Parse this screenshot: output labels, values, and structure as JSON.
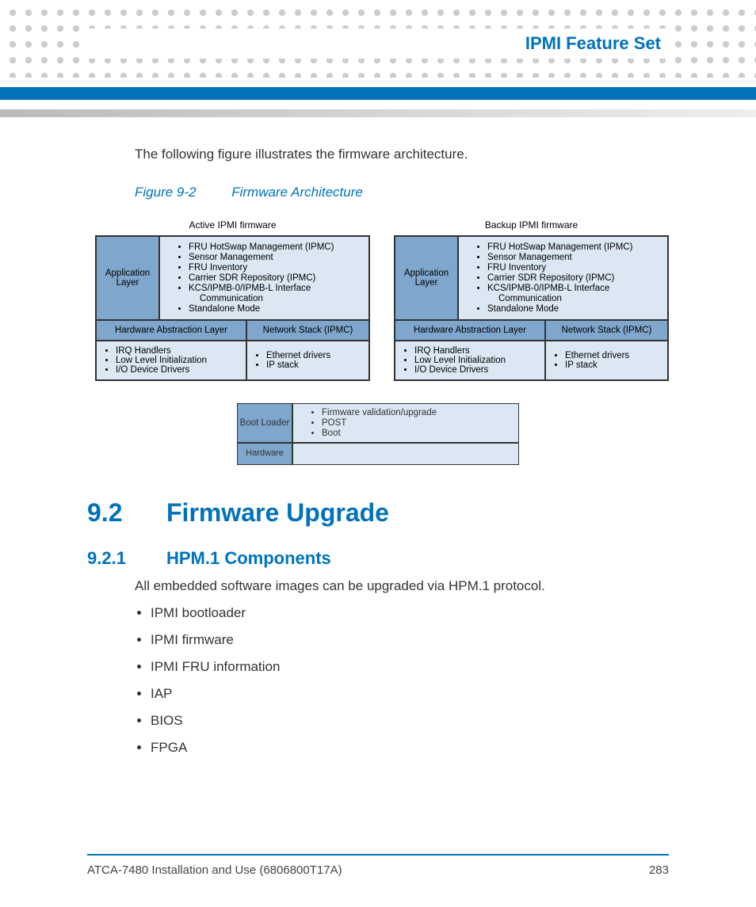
{
  "header": {
    "title": "IPMI Feature Set"
  },
  "intro": "The following figure illustrates the firmware architecture.",
  "figure": {
    "number": "Figure 9-2",
    "title": "Firmware Architecture",
    "active": {
      "title": "Active IPMI firmware",
      "app_label": "Application Layer",
      "app_items": [
        "FRU HotSwap Management (IPMC)",
        "Sensor Management",
        "FRU Inventory",
        "Carrier SDR Repository (IPMC)",
        "KCS/IPMB-0/IPMB-L Interface",
        "Communication",
        "Standalone Mode"
      ],
      "hal_left": "Hardware Abstraction Layer",
      "hal_right": "Network Stack (IPMC)",
      "low_left": [
        "IRQ Handlers",
        "Low Level Initialization",
        "I/O Device Drivers"
      ],
      "low_right": [
        "Ethernet drivers",
        "IP stack"
      ]
    },
    "backup": {
      "title": "Backup IPMI firmware",
      "app_label": "Application Layer",
      "app_items": [
        "FRU HotSwap Management (IPMC)",
        "Sensor Management",
        "FRU Inventory",
        "Carrier SDR Repository (IPMC)",
        "KCS/IPMB-0/IPMB-L Interface",
        "Communication",
        "Standalone Mode"
      ],
      "hal_left": "Hardware Abstraction Layer",
      "hal_right": "Network Stack (IPMC)",
      "low_left": [
        "IRQ Handlers",
        "Low Level Initialization",
        "I/O Device Drivers"
      ],
      "low_right": [
        "Ethernet drivers",
        "IP stack"
      ]
    },
    "boot": {
      "label": "Boot Loader",
      "items": [
        "Firmware validation/upgrade",
        "POST",
        "Boot"
      ],
      "hw_label": "Hardware"
    }
  },
  "section": {
    "num": "9.2",
    "title": "Firmware Upgrade"
  },
  "subsection": {
    "num": "9.2.1",
    "title": "HPM.1 Components",
    "lead": "All embedded software images can be upgraded via HPM.1 protocol.",
    "items": [
      "IPMI bootloader",
      "IPMI firmware",
      "IPMI FRU information",
      "IAP",
      "BIOS",
      "FPGA"
    ]
  },
  "footer": {
    "doc": "ATCA-7480 Installation and Use (6806800T17A)",
    "page": "283"
  }
}
